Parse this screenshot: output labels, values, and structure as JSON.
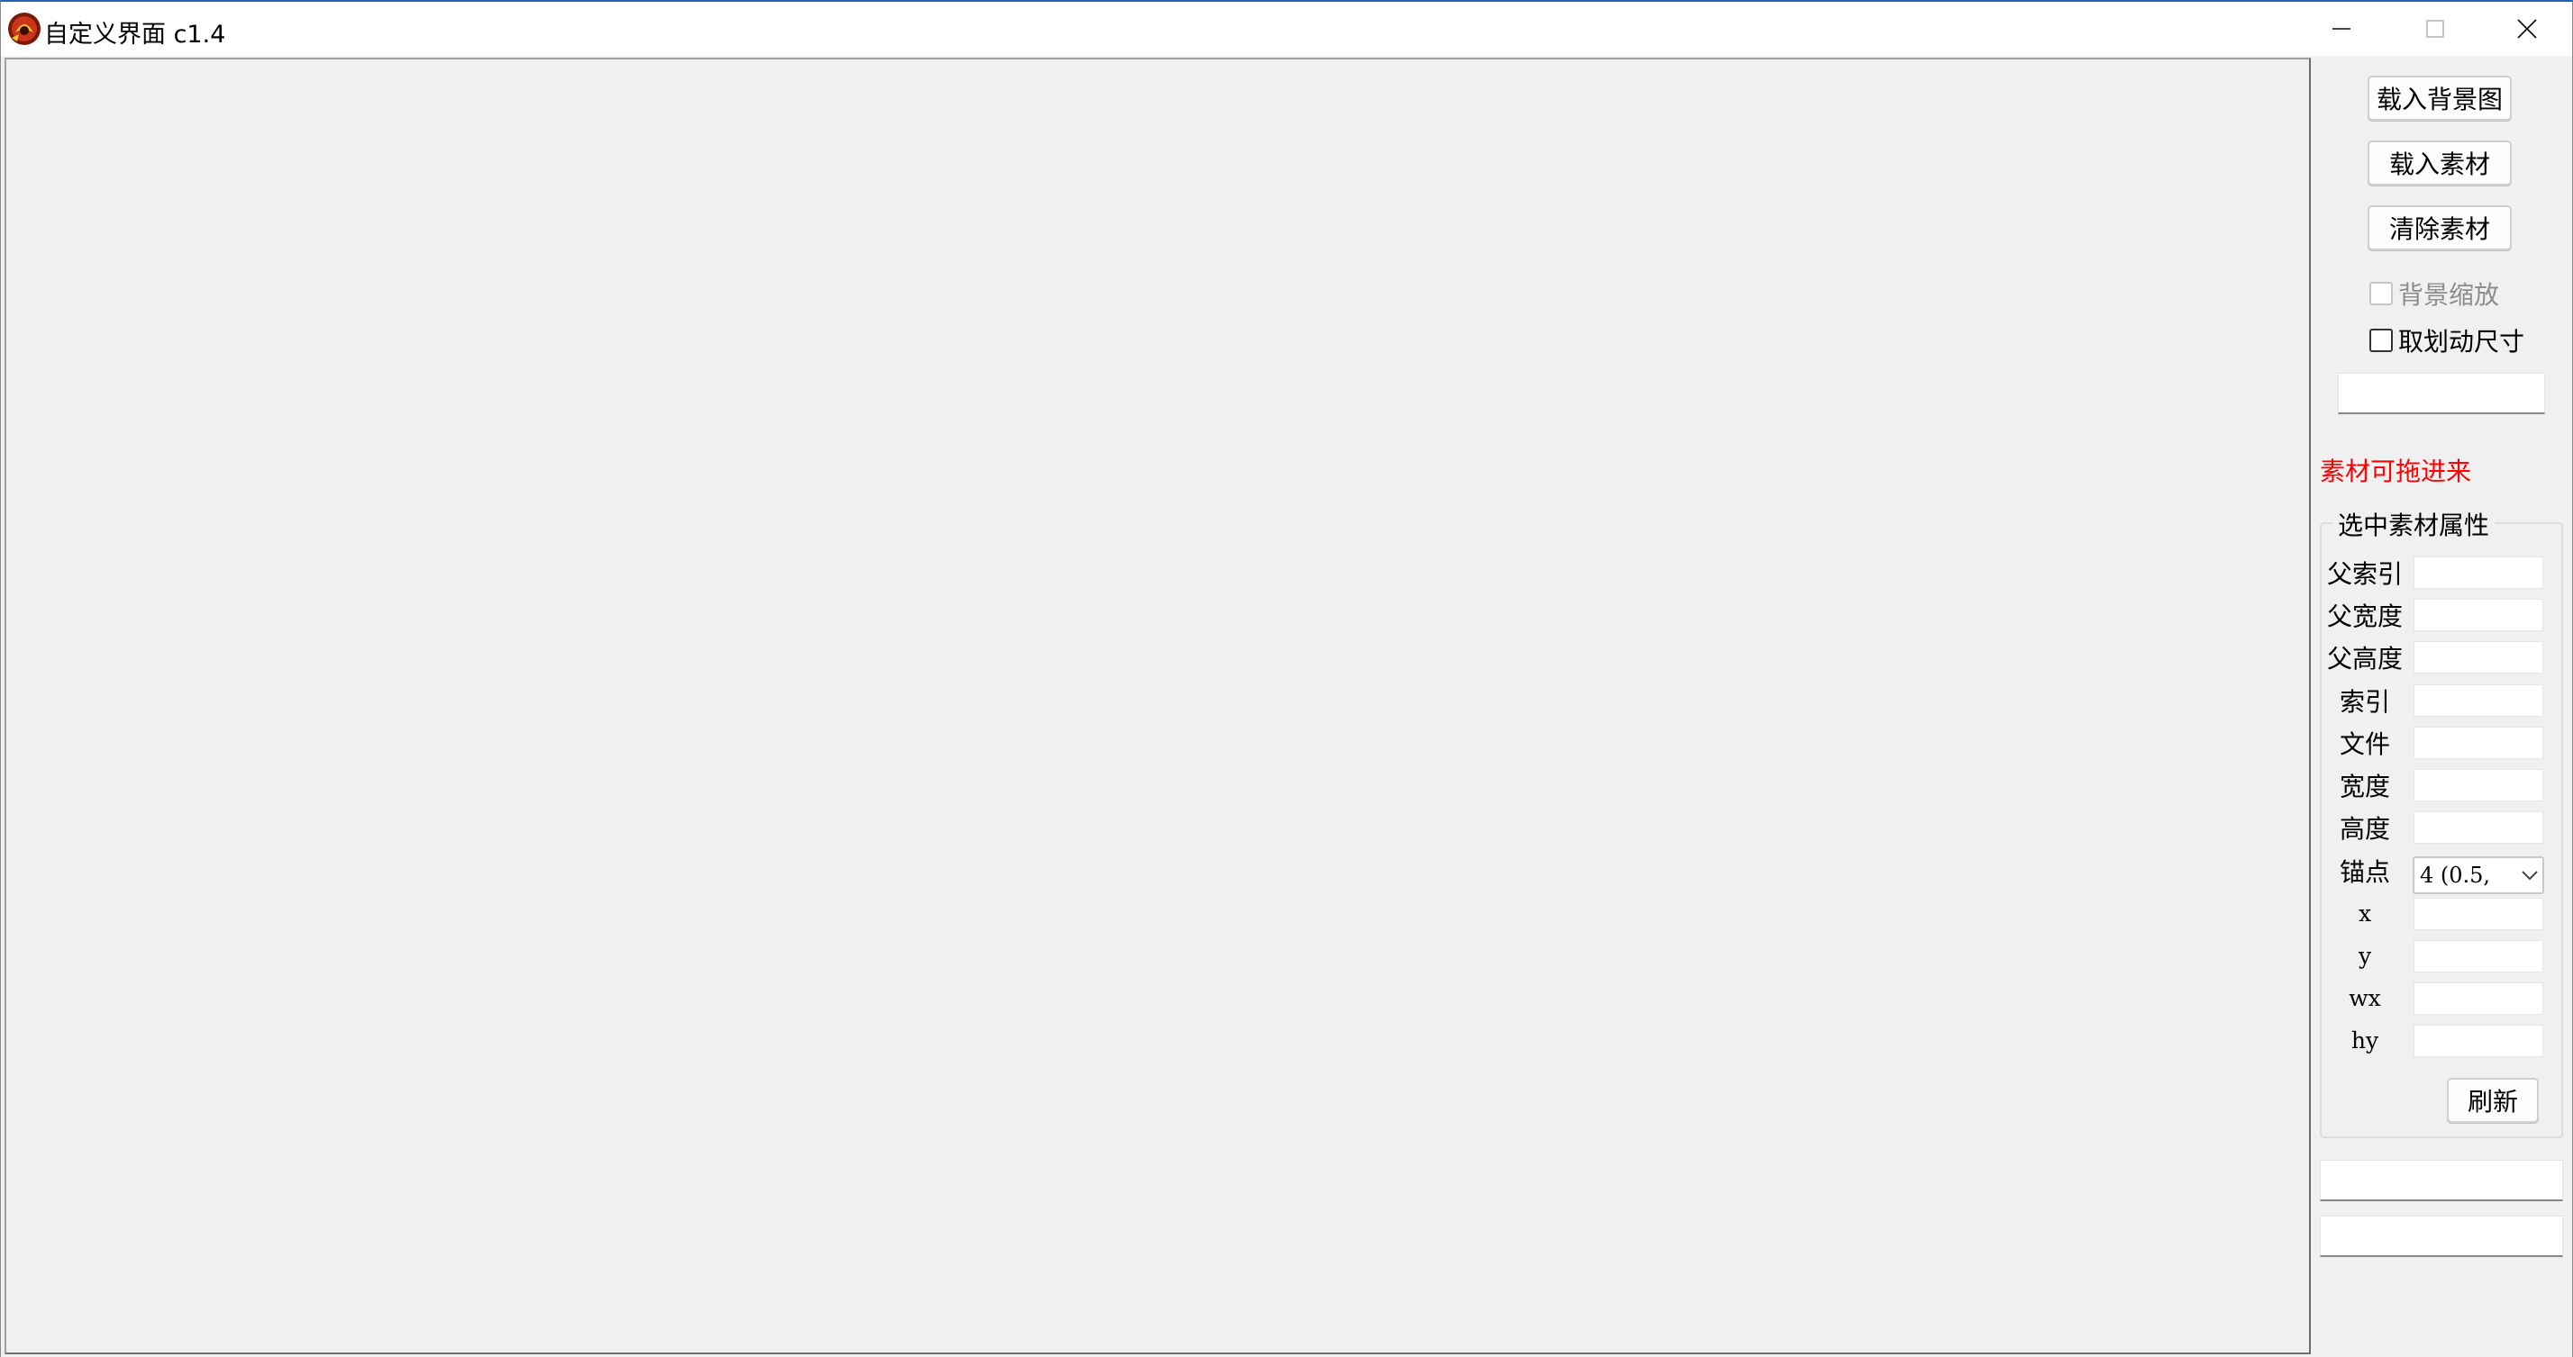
{
  "window": {
    "title": "自定义界面 c1.4",
    "controls": [
      "minimize",
      "maximize",
      "close"
    ]
  },
  "panel": {
    "load_background_label": "载入背景图",
    "load_material_label": "载入素材",
    "clear_material_label": "清除素材",
    "bg_scale_label": "背景缩放",
    "bg_scale_checked": false,
    "bg_scale_enabled": false,
    "snap_size_label": "取划动尺寸",
    "snap_size_checked": false,
    "size_field_value": "",
    "drag_hint": "素材可拖进来",
    "hint_color": "#ff0000",
    "status_field_1": "",
    "status_field_2": ""
  },
  "properties": {
    "group_title": "选中素材属性",
    "rows": [
      {
        "label": "父索引",
        "value": ""
      },
      {
        "label": "父宽度",
        "value": ""
      },
      {
        "label": "父高度",
        "value": ""
      },
      {
        "label": "索引",
        "value": ""
      },
      {
        "label": "文件",
        "value": ""
      },
      {
        "label": "宽度",
        "value": ""
      },
      {
        "label": "高度",
        "value": ""
      }
    ],
    "anchor_label": "锚点",
    "anchor_value": "4 (0.5,",
    "coord_rows": [
      {
        "label": "x",
        "value": ""
      },
      {
        "label": "y",
        "value": ""
      },
      {
        "label": "wx",
        "value": ""
      },
      {
        "label": "hy",
        "value": ""
      }
    ],
    "refresh_label": "刷新"
  },
  "icons": {
    "app": "app-logo-icon",
    "minimize": "minimize-icon",
    "maximize": "maximize-icon",
    "close": "close-icon",
    "dropdown": "chevron-down-icon"
  }
}
